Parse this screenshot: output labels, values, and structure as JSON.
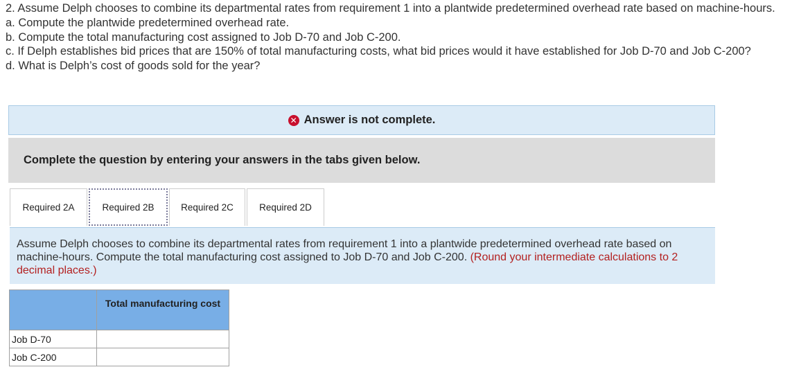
{
  "question": {
    "intro": "2. Assume Delph chooses to combine its departmental rates from requirement 1 into a plantwide predetermined overhead rate based on machine-hours.",
    "part_a": "a. Compute the plantwide predetermined overhead rate.",
    "part_b": "b. Compute the total manufacturing cost assigned to Job D-70 and Job C-200.",
    "part_c": "c. If Delph establishes bid prices that are 150% of total manufacturing costs, what bid prices would it have established for Job D-70 and Job C-200?",
    "part_d": "d. What is Delph’s cost of goods sold for the year?"
  },
  "status": {
    "icon": "x-circle-icon",
    "text": "Answer is not complete.",
    "icon_color": "#c8102e"
  },
  "instruction": "Complete the question by entering your answers in the tabs given below.",
  "tabs": [
    {
      "label": "Required 2A"
    },
    {
      "label": "Required 2B"
    },
    {
      "label": "Required 2C"
    },
    {
      "label": "Required 2D"
    }
  ],
  "active_tab": "Required 2B",
  "tab_content": {
    "text": "Assume Delph chooses to combine its departmental rates from requirement 1 into a plantwide predetermined overhead rate based on machine-hours. Compute the total manufacturing cost assigned to Job D-70 and Job C-200.",
    "note": "(Round your intermediate calculations to 2 decimal places.)"
  },
  "table": {
    "header_blank": "",
    "header_col": "Total manufacturing cost",
    "rows": [
      {
        "label": "Job D-70",
        "value": ""
      },
      {
        "label": "Job C-200",
        "value": ""
      }
    ]
  },
  "colors": {
    "status_bg": "#dcebf7",
    "instruction_bg": "#dcdcdc",
    "table_header_bg": "#78aee6",
    "note_red": "#b32020"
  }
}
